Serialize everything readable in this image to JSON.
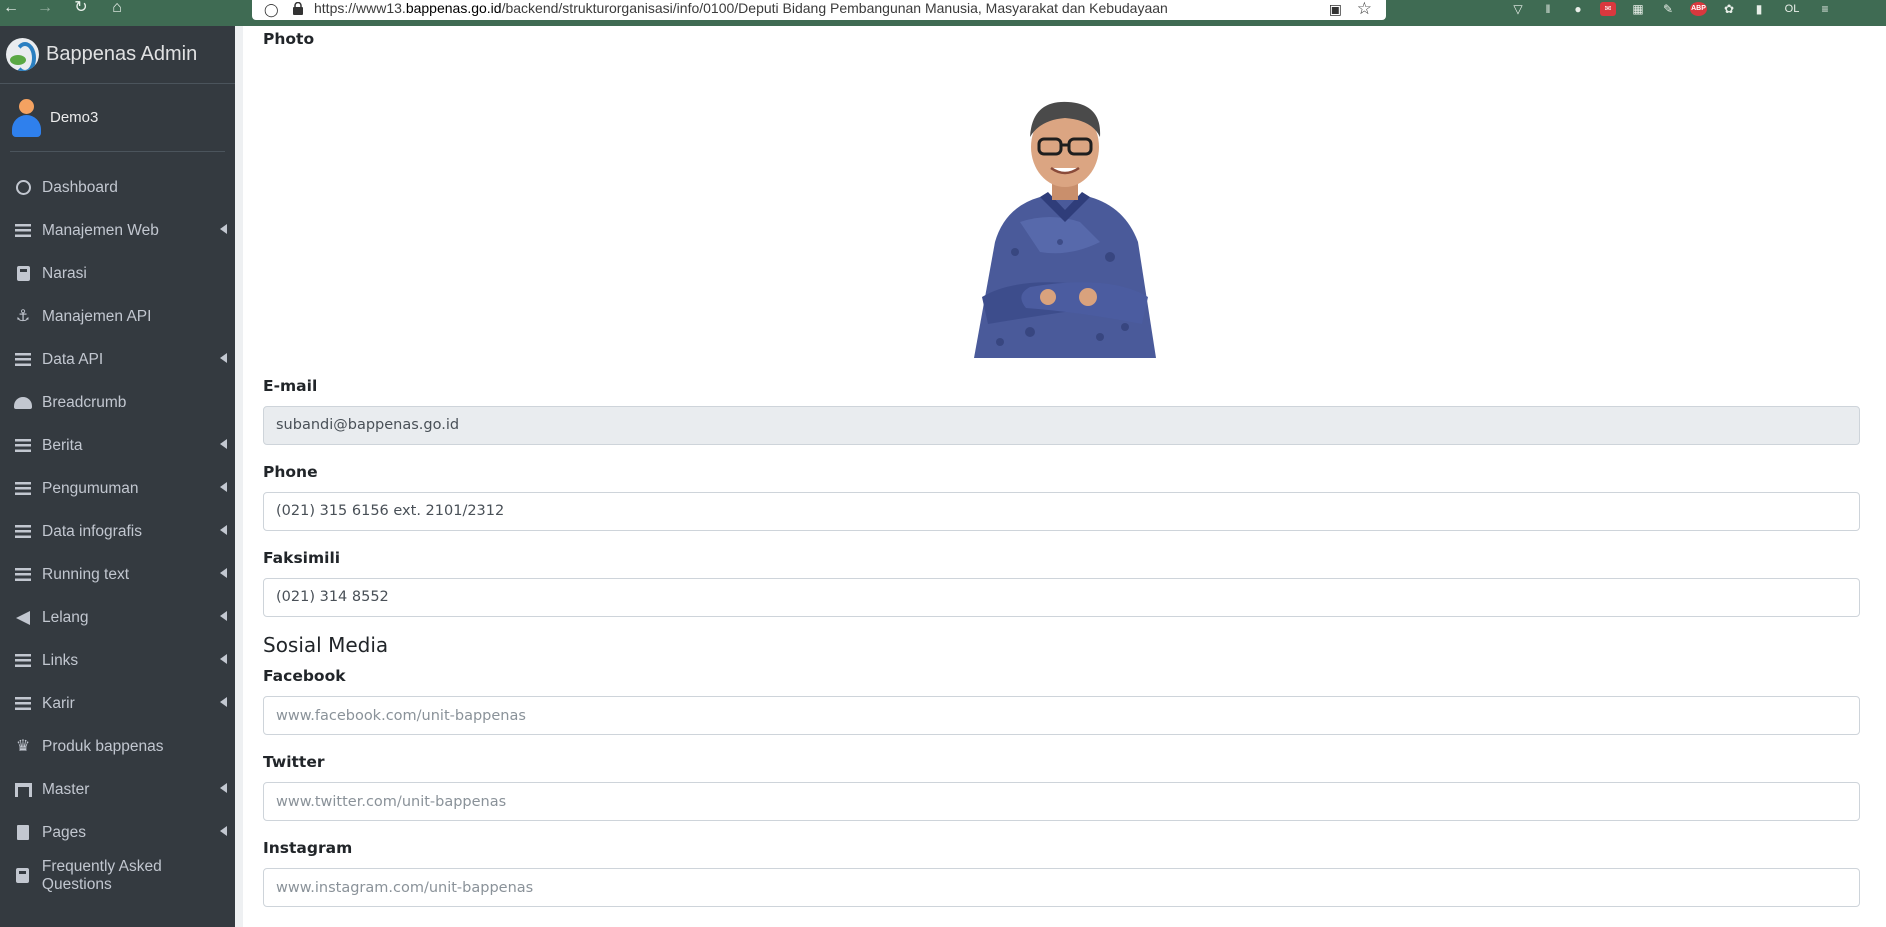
{
  "browser": {
    "url_prefix": "https://www13.",
    "url_domain": "bappenas.go.id",
    "url_path": "/backend/strukturorganisasi/info/0100/Deputi Bidang Pembangunan Manusia, Masyarakat dan Kebudayaan",
    "ext_abp": "ABP",
    "ext_ol": "OL"
  },
  "sidebar": {
    "brand": "Bappenas Admin",
    "user": "Demo3",
    "items": [
      {
        "label": "Dashboard",
        "icon": "circle-icon",
        "submenu": false
      },
      {
        "label": "Manajemen Web",
        "icon": "list-icon",
        "submenu": true
      },
      {
        "label": "Narasi",
        "icon": "book-icon",
        "submenu": false
      },
      {
        "label": "Manajemen API",
        "icon": "anchor-icon",
        "submenu": false
      },
      {
        "label": "Data API",
        "icon": "list-icon",
        "submenu": true
      },
      {
        "label": "Breadcrumb",
        "icon": "graduation-cap-icon",
        "submenu": false
      },
      {
        "label": "Berita",
        "icon": "list-icon",
        "submenu": true
      },
      {
        "label": "Pengumuman",
        "icon": "list-icon",
        "submenu": true
      },
      {
        "label": "Data infografis",
        "icon": "list-icon",
        "submenu": true
      },
      {
        "label": "Running text",
        "icon": "list-icon",
        "submenu": true
      },
      {
        "label": "Lelang",
        "icon": "megaphone-icon",
        "submenu": true
      },
      {
        "label": "Links",
        "icon": "list-icon",
        "submenu": true
      },
      {
        "label": "Karir",
        "icon": "list-icon",
        "submenu": true
      },
      {
        "label": "Produk bappenas",
        "icon": "crown-icon",
        "submenu": false
      },
      {
        "label": "Master",
        "icon": "archway-icon",
        "submenu": true
      },
      {
        "label": "Pages",
        "icon": "file-code-icon",
        "submenu": true
      },
      {
        "label": "Frequently Asked Questions",
        "icon": "book-icon",
        "submenu": false
      }
    ]
  },
  "form": {
    "photo_label": "Photo",
    "email_label": "E-mail",
    "email_value": "subandi@bappenas.go.id",
    "phone_label": "Phone",
    "phone_value": "(021) 315 6156 ext. 2101/2312",
    "fax_label": "Faksimili",
    "fax_value": "(021) 314 8552",
    "social_title": "Sosial Media",
    "facebook_label": "Facebook",
    "facebook_placeholder": "www.facebook.com/unit-bappenas",
    "twitter_label": "Twitter",
    "twitter_placeholder": "www.twitter.com/unit-bappenas",
    "instagram_label": "Instagram",
    "instagram_placeholder": "www.instagram.com/unit-bappenas"
  }
}
